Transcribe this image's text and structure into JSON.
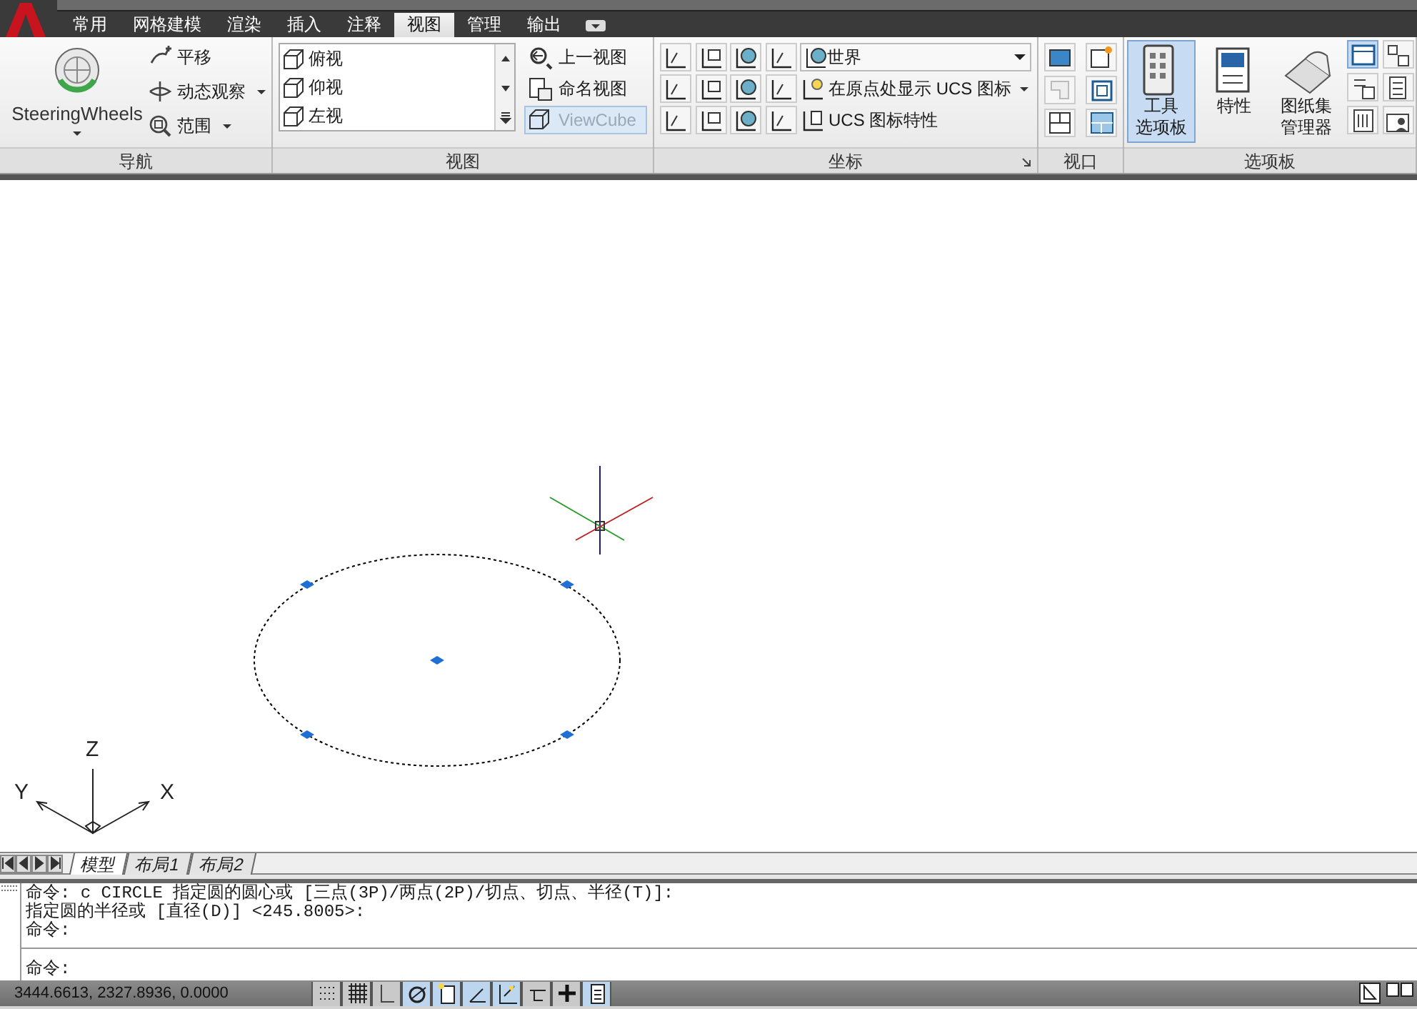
{
  "ribbon_tabs": [
    {
      "label": "常用",
      "selected": false
    },
    {
      "label": "网格建模",
      "selected": false
    },
    {
      "label": "渲染",
      "selected": false
    },
    {
      "label": "插入",
      "selected": false
    },
    {
      "label": "注释",
      "selected": false
    },
    {
      "label": "视图",
      "selected": true
    },
    {
      "label": "管理",
      "selected": false
    },
    {
      "label": "输出",
      "selected": false
    }
  ],
  "navigation": {
    "title": "导航",
    "steering_wheels": "SteeringWheels",
    "tools": [
      {
        "label": "平移",
        "dropdown": false
      },
      {
        "label": "动态观察",
        "dropdown": true
      },
      {
        "label": "范围",
        "dropdown": true
      }
    ]
  },
  "views": {
    "title": "视图",
    "list": [
      "俯视",
      "仰视",
      "左视"
    ],
    "buttons": [
      {
        "label": "上一视图",
        "selected": false
      },
      {
        "label": "命名视图",
        "selected": false
      },
      {
        "label": "ViewCube",
        "selected": true
      }
    ]
  },
  "coordinates": {
    "title": "坐标",
    "ucs_dropdown": "世界",
    "show_at_origin": "在原点处显示 UCS 图标",
    "icon_properties": "UCS 图标特性"
  },
  "viewports": {
    "title": "视口"
  },
  "palettes": {
    "title": "选项板",
    "buttons": [
      {
        "lines": [
          "工具",
          "选项板"
        ],
        "selected": true
      },
      {
        "lines": [
          "特性"
        ],
        "selected": false
      },
      {
        "lines": [
          "图纸集",
          "管理器"
        ],
        "selected": false
      }
    ]
  },
  "canvas": {
    "circle_selected": true,
    "ucs_icon": {
      "x": "X",
      "y": "Y",
      "z": "Z"
    }
  },
  "layout_tabs": [
    {
      "label": "模型",
      "selected": true
    },
    {
      "label": "布局1",
      "selected": false
    },
    {
      "label": "布局2",
      "selected": false
    }
  ],
  "command_history": [
    "命令: c CIRCLE 指定圆的圆心或 [三点(3P)/两点(2P)/切点、切点、半径(T)]:",
    "指定圆的半径或 [直径(D)] <245.8005>:",
    "命令:"
  ],
  "command_prompt": "命令:",
  "status_bar": {
    "coordinates": "3444.6613, 2327.8936, 0.0000",
    "toggles": [
      {
        "kind": "snap",
        "on": false
      },
      {
        "kind": "grid",
        "on": false
      },
      {
        "kind": "ortho",
        "on": false
      },
      {
        "kind": "polar",
        "on": true
      },
      {
        "kind": "osnap",
        "on": true
      },
      {
        "kind": "otrack",
        "on": true
      },
      {
        "kind": "ducs",
        "on": true
      },
      {
        "kind": "dyn",
        "on": false
      },
      {
        "kind": "lwt",
        "on": false
      },
      {
        "kind": "qp",
        "on": true
      }
    ]
  }
}
